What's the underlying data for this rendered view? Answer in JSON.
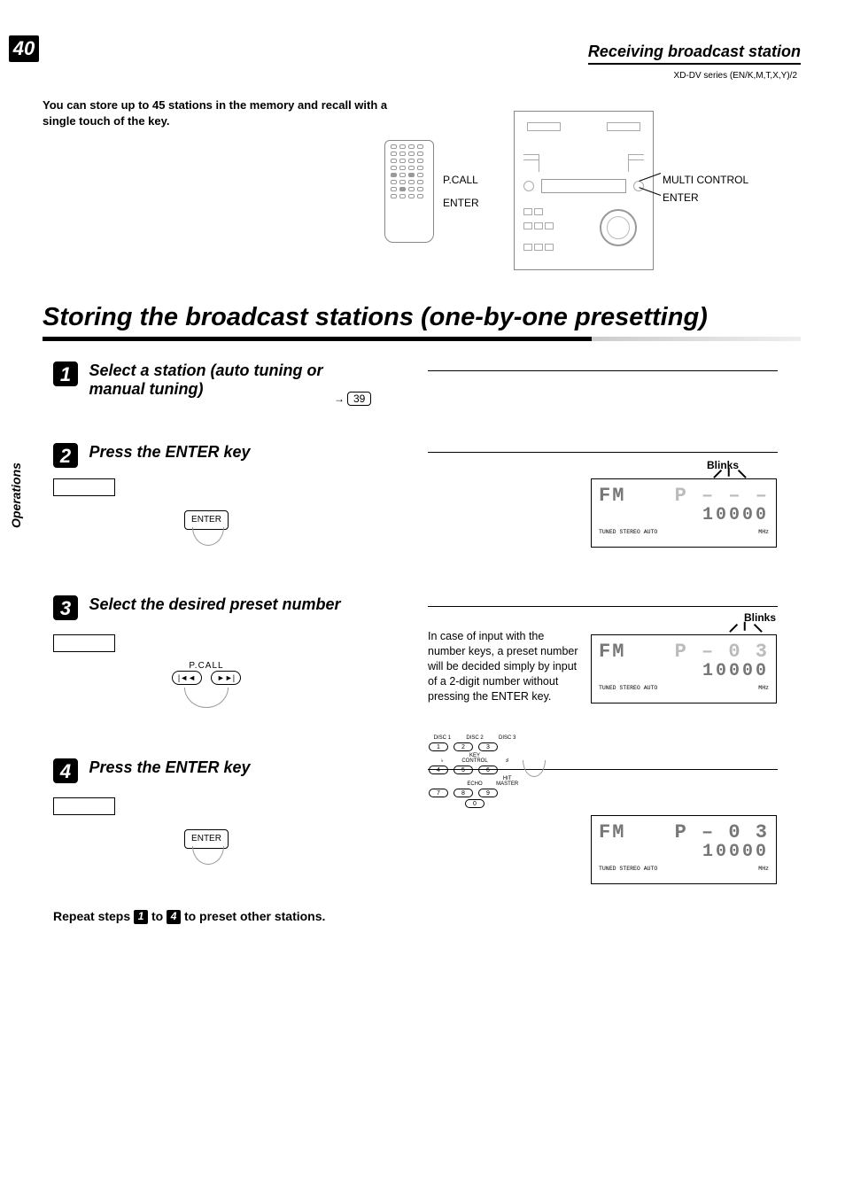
{
  "page_number": "40",
  "section_header": "Receiving broadcast station",
  "doc_code": "XD-DV series (EN/K,M,T,X,Y)/2",
  "intro": "You can store up to 45 stations in the memory and recall with a single touch of the key.",
  "remote_labels": {
    "pcall": "P.CALL",
    "enter": "ENTER"
  },
  "unit_labels": {
    "multi_control": "MULTI CONTROL",
    "enter": "ENTER"
  },
  "main_title": "Storing the broadcast stations (one-by-one presetting)",
  "side_tab": "Operations",
  "page_ref_39": "39",
  "steps": {
    "s1": {
      "n": "1",
      "title": "Select a station (auto tuning or manual tuning)"
    },
    "s2": {
      "n": "2",
      "title": "Press the ENTER key"
    },
    "s3": {
      "n": "3",
      "title": "Select the desired preset number"
    },
    "s4": {
      "n": "4",
      "title": "Press the ENTER key"
    }
  },
  "btn_labels": {
    "enter": "ENTER",
    "pcall": "P.CALL"
  },
  "right_note": "In case of input with the number keys, a preset number will be decided simply by input of a 2-digit number without pressing the ENTER key.",
  "numpad": {
    "top_labels": [
      "DISC 1",
      "DISC 2",
      "DISC 3"
    ],
    "row1": [
      "1",
      "2",
      "3"
    ],
    "mid_labels_l": "♭",
    "mid_labels_c": "KEY CONTROL",
    "mid_labels_r": "♯",
    "row2": [
      "4",
      "5",
      "6"
    ],
    "bot_labels_l": "",
    "bot_labels_c": "ECHO",
    "bot_labels_r": "HIT MASTER",
    "row3": [
      "7",
      "8",
      "9"
    ],
    "row4": [
      "0"
    ]
  },
  "blinks": "Blinks",
  "lcd": {
    "band": "FM",
    "tuned": "TUNED STEREO AUTO",
    "mhz": "MHz",
    "d1": {
      "top_right": "P – – –",
      "bottom": "10000"
    },
    "d2": {
      "top_right": "P – 0 3",
      "bottom": "10000"
    },
    "d3": {
      "top_right": "P – 0 3",
      "bottom": "10000"
    }
  },
  "repeat_text_a": "Repeat steps ",
  "repeat_text_b": " to ",
  "repeat_text_c": " to preset other stations.",
  "repeat_from": "1",
  "repeat_to": "4"
}
